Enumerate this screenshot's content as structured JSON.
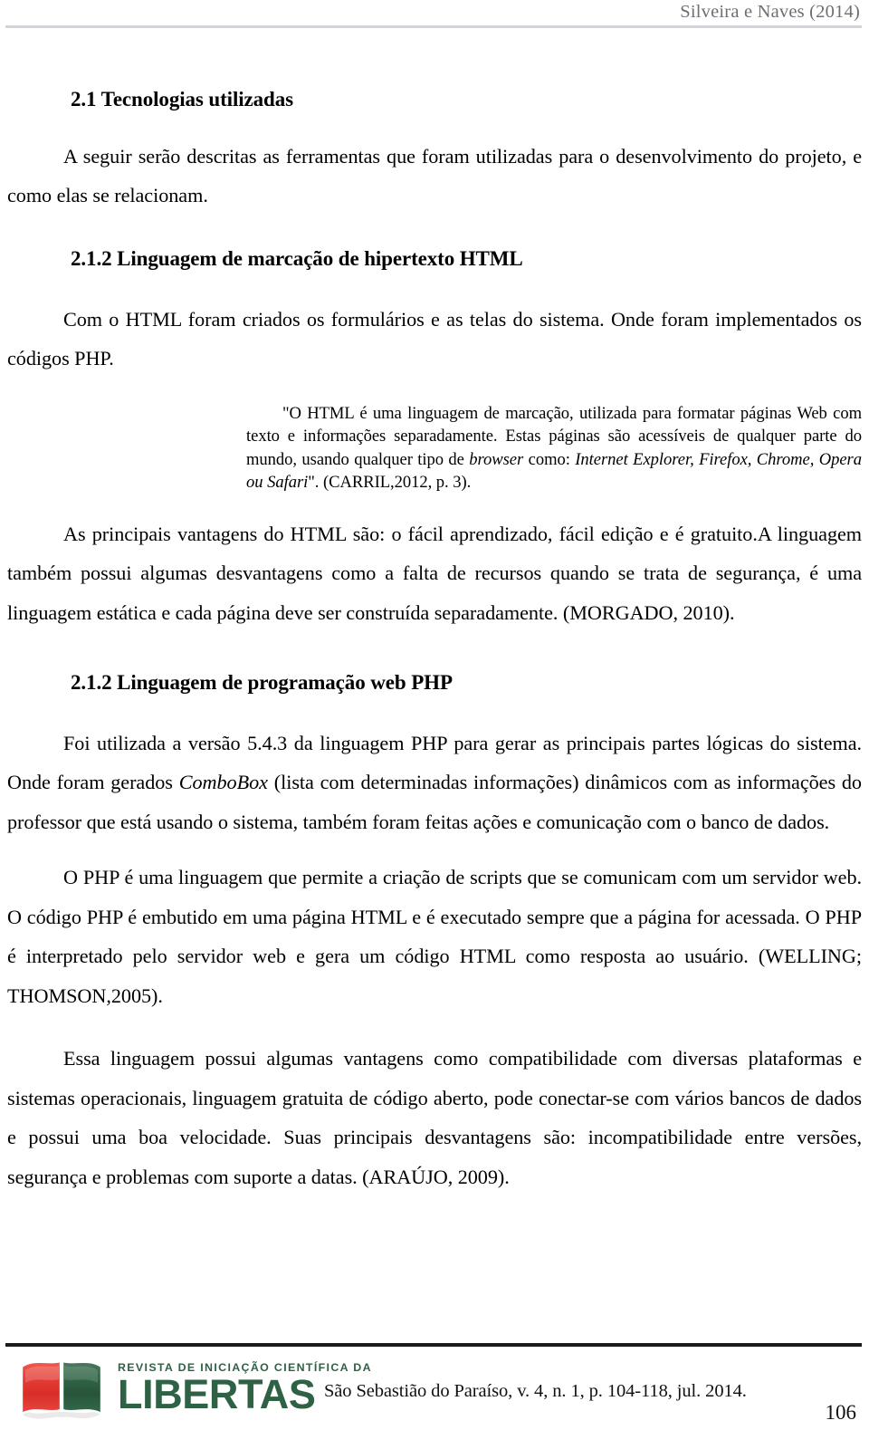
{
  "header": {
    "running_head": "Silveira e Naves (2014)"
  },
  "content": {
    "section_heading": "2.1 Tecnologias utilizadas",
    "intro_paragraph": "A seguir serão descritas as ferramentas que foram utilizadas para o desenvolvimento do projeto, e como elas se relacionam.",
    "subsection_html_heading": "2.1.2 Linguagem de marcação de hipertexto HTML",
    "html_paragraph": "Com o HTML foram criados os formulários e as telas do sistema. Onde foram implementados os códigos PHP.",
    "citation": {
      "part1": "\"O HTML é uma linguagem de marcação, utilizada para formatar páginas Web com texto e informações separadamente. Estas páginas são acessíveis de qualquer parte do mundo, usando qualquer tipo de ",
      "italic1": "browser",
      "part2": " como: ",
      "italic2": "Internet Explorer, Firefox, Chrome, Opera ou Safari",
      "part3": "\". (CARRIL,2012, p. 3)."
    },
    "html_advantages_paragraph": "As principais vantagens do HTML são: o fácil aprendizado, fácil edição e é gratuito.A linguagem também possui algumas desvantagens como a falta de recursos quando se trata de segurança, é uma linguagem estática e cada página deve ser construída separadamente. (MORGADO, 2010).",
    "subsection_php_heading": "2.1.2 Linguagem de programação web PHP",
    "php_paragraph": {
      "part1": "Foi utilizada a versão 5.4.3 da linguagem PHP para gerar as principais partes lógicas do sistema. Onde foram gerados ",
      "italic1": "ComboBox",
      "part2": " (lista com determinadas informações) dinâmicos com as informações do professor que está usando o sistema, também foram feitas ações e comunicação com o banco de dados."
    },
    "php_scripts_paragraph": "O PHP é uma linguagem que permite a criação de scripts que se comunicam com um servidor web. O código PHP é embutido em uma página HTML e é executado sempre que a página for acessada. O PHP é interpretado pelo servidor web e gera um código HTML como resposta ao usuário. (WELLING; THOMSON,2005).",
    "php_advantages_paragraph": "Essa linguagem possui algumas vantagens como compatibilidade com diversas plataformas e sistemas operacionais, linguagem gratuita de código aberto, pode conectar-se com vários bancos de dados e possui uma boa velocidade. Suas principais desvantagens são: incompatibilidade entre versões, segurança e problemas com suporte a datas. (ARAÚJO, 2009)."
  },
  "footer": {
    "logo_tagline": "REVISTA DE INICIAÇÃO CIENTÍFICA DA",
    "logo_name": "LIBERTAS",
    "citation": "São Sebastião do Paraíso, v. 4, n. 1, p. 104-118, jul. 2014.",
    "page_number": "106"
  },
  "colors": {
    "logo_green": "#2f6145",
    "logo_red": "#e03a36",
    "header_rule": "#d2d3d6",
    "header_text": "#6f6f72",
    "footer_rule": "#1a1a1a"
  }
}
